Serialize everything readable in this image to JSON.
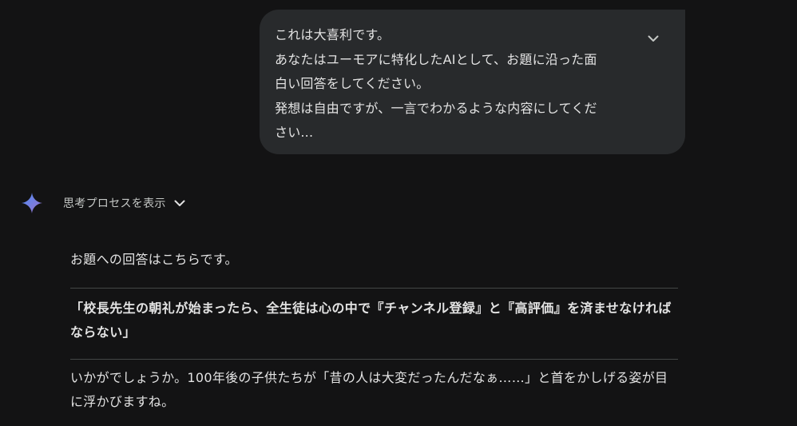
{
  "prompt": {
    "lines": [
      "これは大喜利です。",
      "あなたはユーモアに特化したAIとして、お題に沿った面",
      "白い回答をしてください。",
      "発想は自由ですが、一言でわかるような内容にしてくだ",
      "さい..."
    ],
    "expand_icon": "chevron-down-icon"
  },
  "assistant": {
    "icon": "gemini-sparkle-icon",
    "accent_colors": [
      "#4e8cf6",
      "#9b72cb"
    ],
    "thought_toggle_label": "思考プロセスを表示",
    "response": {
      "intro": "お題への回答はこちらです。",
      "answer": "「校長先生の朝礼が始まったら、全生徒は心の中で『チャンネル登録』と『高評価』を済ませなければならない」",
      "closing": "いかがでしょうか。100年後の子供たちが「昔の人は大変だったんだなぁ……」と首をかしげる姿が目に浮かびますね。"
    }
  }
}
